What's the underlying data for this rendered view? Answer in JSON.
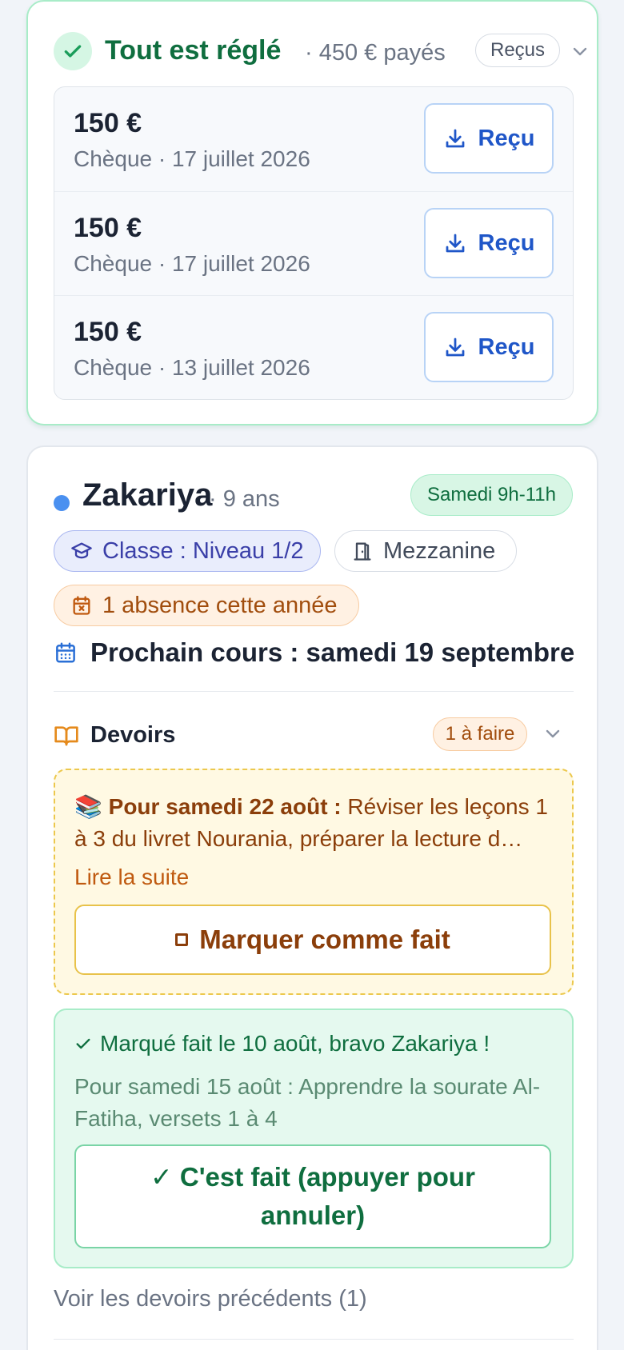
{
  "payment": {
    "title": "Tout est réglé",
    "summary": "· 450 € payés",
    "receipts_pill": "Reçus",
    "rows": [
      {
        "amount": "150 €",
        "meta": "Chèque · 17 juillet 2026",
        "button": "Reçu"
      },
      {
        "amount": "150 €",
        "meta": "Chèque · 17 juillet 2026",
        "button": "Reçu"
      },
      {
        "amount": "150 €",
        "meta": "Chèque · 13 juillet 2026",
        "button": "Reçu"
      }
    ]
  },
  "student": {
    "name": "Zakariya",
    "age": "· 9 ans",
    "schedule": "Samedi 9h-11h",
    "class_chip": "Classe : Niveau 1/2",
    "room_chip": "Mezzanine",
    "absence_chip": "1 absence cette année",
    "next_course": "Prochain cours : samedi 19 septembre"
  },
  "homework": {
    "title": "Devoirs",
    "todo_pill": "1 à faire",
    "pending": {
      "emoji": "📚",
      "due": "Pour samedi 22 août :",
      "text": "Réviser les leçons 1 à 3 du livret Nourania, préparer la lecture d…",
      "read_more": "Lire la suite",
      "button": "Marquer comme fait"
    },
    "done": {
      "status": "Marqué fait le 10 août, bravo Zakariya !",
      "desc": "Pour samedi 15 août : Apprendre la sourate Al-Fatiha, versets 1 à 4",
      "button": "✓ C'est fait (appuyer pour annuler)"
    },
    "previous_link": "Voir les devoirs précédents (1)"
  },
  "colors": {
    "success": "#0f6e3f",
    "accent_blue": "#1f56c8",
    "warning": "#8b3e0a",
    "student_dot": "#4a90f0"
  }
}
